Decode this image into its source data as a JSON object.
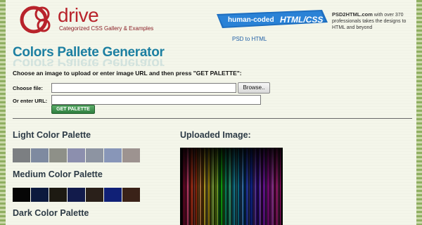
{
  "header": {
    "logo_text": "drive",
    "logo_tagline": "Categorized CSS Gallery & Examples",
    "ad_ribbon_left": "human-coded",
    "ad_ribbon_right": "HTML/CSS",
    "ad_brand": "PSD2HTML.com",
    "ad_copy": "with over 370 professionals takes the designs to HTML and beyond",
    "ad_link": "PSD to HTML"
  },
  "main": {
    "title": "Colors Pallete Generator",
    "instruction": "Choose an image to upload or enter image URL and then press \"GET PALETTE\":",
    "form": {
      "file_label": "Choose file:",
      "browse_label": "Browse..",
      "url_label": "Or enter URL:",
      "url_value": "",
      "submit_label": "GET PALETTE"
    }
  },
  "results": {
    "light_heading": "Light Color Palette",
    "light_colors": [
      "#7c7f82",
      "#7e8aa0",
      "#8e9088",
      "#8c8fae",
      "#8d94a2",
      "#8896b8",
      "#9d9390"
    ],
    "medium_heading": "Medium Color Palette",
    "medium_colors": [
      "#060606",
      "#0c1a3d",
      "#1d1a12",
      "#121b4b",
      "#2a201a",
      "#102076",
      "#3a2218"
    ],
    "dark_heading": "Dark Color Palette",
    "uploaded_heading": "Uploaded Image:"
  },
  "colors": {
    "brand_red": "#b8232b",
    "title_blue": "#1c7fa1",
    "button_green": "#2e7d3f",
    "ribbon_blue": "#1f6fc0"
  }
}
